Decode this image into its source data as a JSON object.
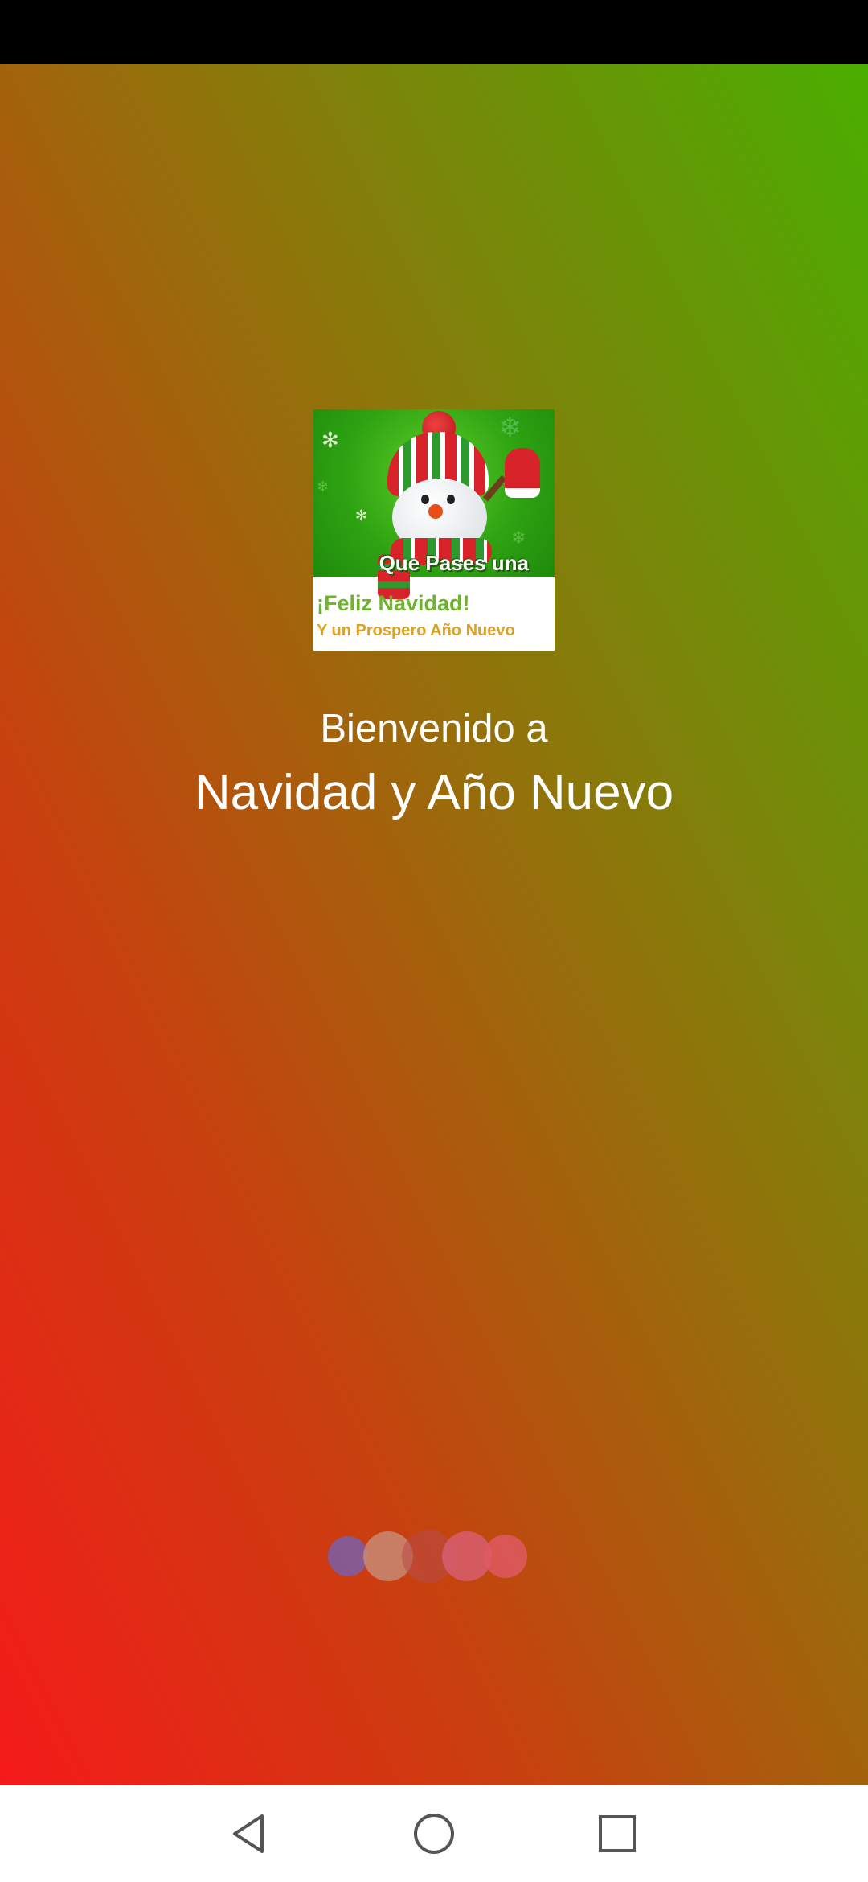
{
  "splash": {
    "welcome_text": "Bienvenido a",
    "app_name": "Navidad y Año Nuevo"
  },
  "app_icon": {
    "line1": "Que Pases una",
    "line2": "¡Feliz   Navidad!",
    "line3": "Y un Prospero Año Nuevo"
  },
  "colors": {
    "gradient_bottom_left": "#f51a1a",
    "gradient_top_right": "#4aae00",
    "status_bar": "#000000",
    "nav_bar": "#ffffff",
    "loader_dots": [
      "#7a5fa8",
      "#c88a74",
      "#b84a4a",
      "#d85f76",
      "#e05a66"
    ]
  },
  "nav": {
    "icons": [
      "back-icon",
      "home-icon",
      "recents-icon"
    ]
  }
}
